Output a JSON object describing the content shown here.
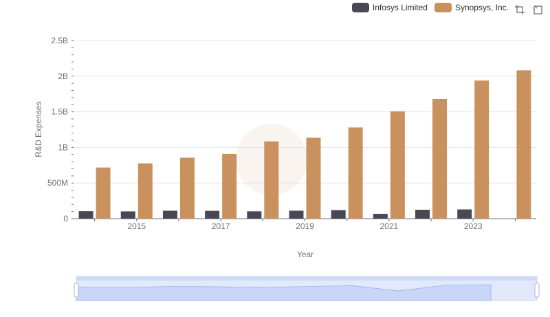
{
  "legend": {
    "items": [
      {
        "name": "Infosys Limited",
        "color": "#474854"
      },
      {
        "name": "Synopsys, Inc.",
        "color": "#c8915e"
      }
    ]
  },
  "toolbox": {
    "icons": [
      "zoom-icon",
      "restore-icon"
    ]
  },
  "chart_data": {
    "type": "bar",
    "categories": [
      "2014",
      "2015",
      "2016",
      "2017",
      "2018",
      "2019",
      "2020",
      "2021",
      "2022",
      "2023",
      "2024"
    ],
    "x_tick_labels": [
      "2015",
      "2017",
      "2019",
      "2021",
      "2023"
    ],
    "xlabel": "Year",
    "ylabel": "R&D Expenses",
    "ylim": [
      0,
      2500000000
    ],
    "y_tick_values": [
      0,
      500000000,
      1000000000,
      1500000000,
      2000000000,
      2500000000
    ],
    "y_tick_labels": [
      "0",
      "500M",
      "1B",
      "1.5B",
      "2B",
      "2.5B"
    ],
    "grid": true,
    "legend_position": "top-right",
    "series": [
      {
        "name": "Infosys Limited",
        "color": "#474854",
        "values": [
          105000000,
          102000000,
          112000000,
          110000000,
          103000000,
          112000000,
          120000000,
          68000000,
          125000000,
          130000000,
          null
        ]
      },
      {
        "name": "Synopsys, Inc.",
        "color": "#c8915e",
        "values": [
          718000000,
          776000000,
          856000000,
          908000000,
          1085000000,
          1137000000,
          1280000000,
          1507000000,
          1680000000,
          1939000000,
          2082000000
        ]
      }
    ],
    "data_zoom": {
      "start_percent": 0,
      "end_percent": 100
    }
  }
}
